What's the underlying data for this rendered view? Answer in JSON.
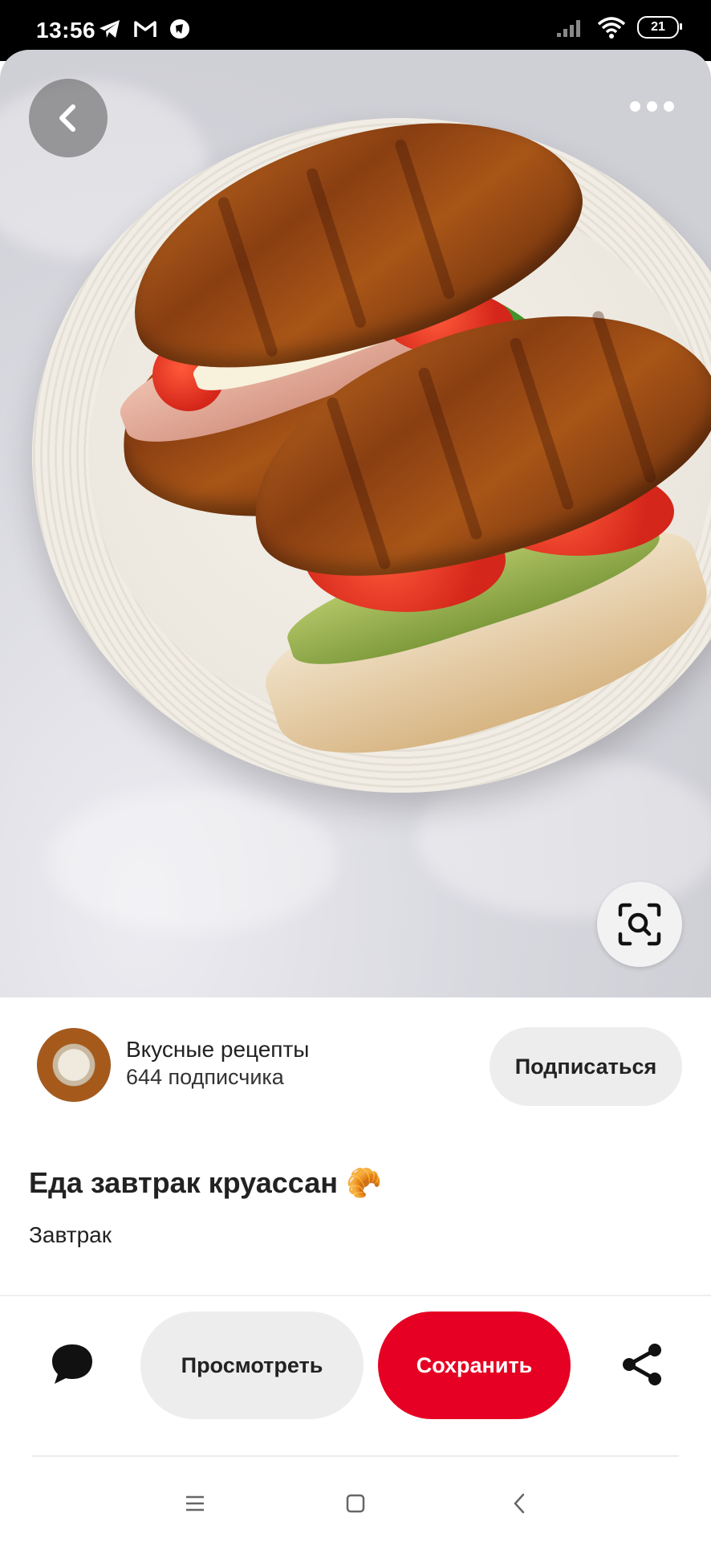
{
  "status_bar": {
    "time": "13:56",
    "battery": "21",
    "icons_left": [
      "telegram-icon",
      "gmail-icon",
      "app-icon"
    ],
    "icons_right": [
      "signal-icon",
      "wifi-icon",
      "battery-icon"
    ]
  },
  "pin": {
    "image_description_icon": "photo",
    "back_icon": "chevron-left-icon",
    "more_icon": "more-horizontal-icon",
    "lens_icon": "visual-search-icon"
  },
  "creator": {
    "name": "Вкусные рецепты",
    "followers": "644 подписчика",
    "follow_label": "Подписаться"
  },
  "details": {
    "title": "Еда завтрак круассан 🥐",
    "subtitle": "Завтрак"
  },
  "actions": {
    "view_label": "Просмотреть",
    "save_label": "Сохранить",
    "save_color": "#e60023",
    "comment_icon": "comment-icon",
    "share_icon": "share-icon"
  },
  "navbar": {
    "items": [
      "menu-icon",
      "home-icon",
      "back-icon"
    ]
  }
}
